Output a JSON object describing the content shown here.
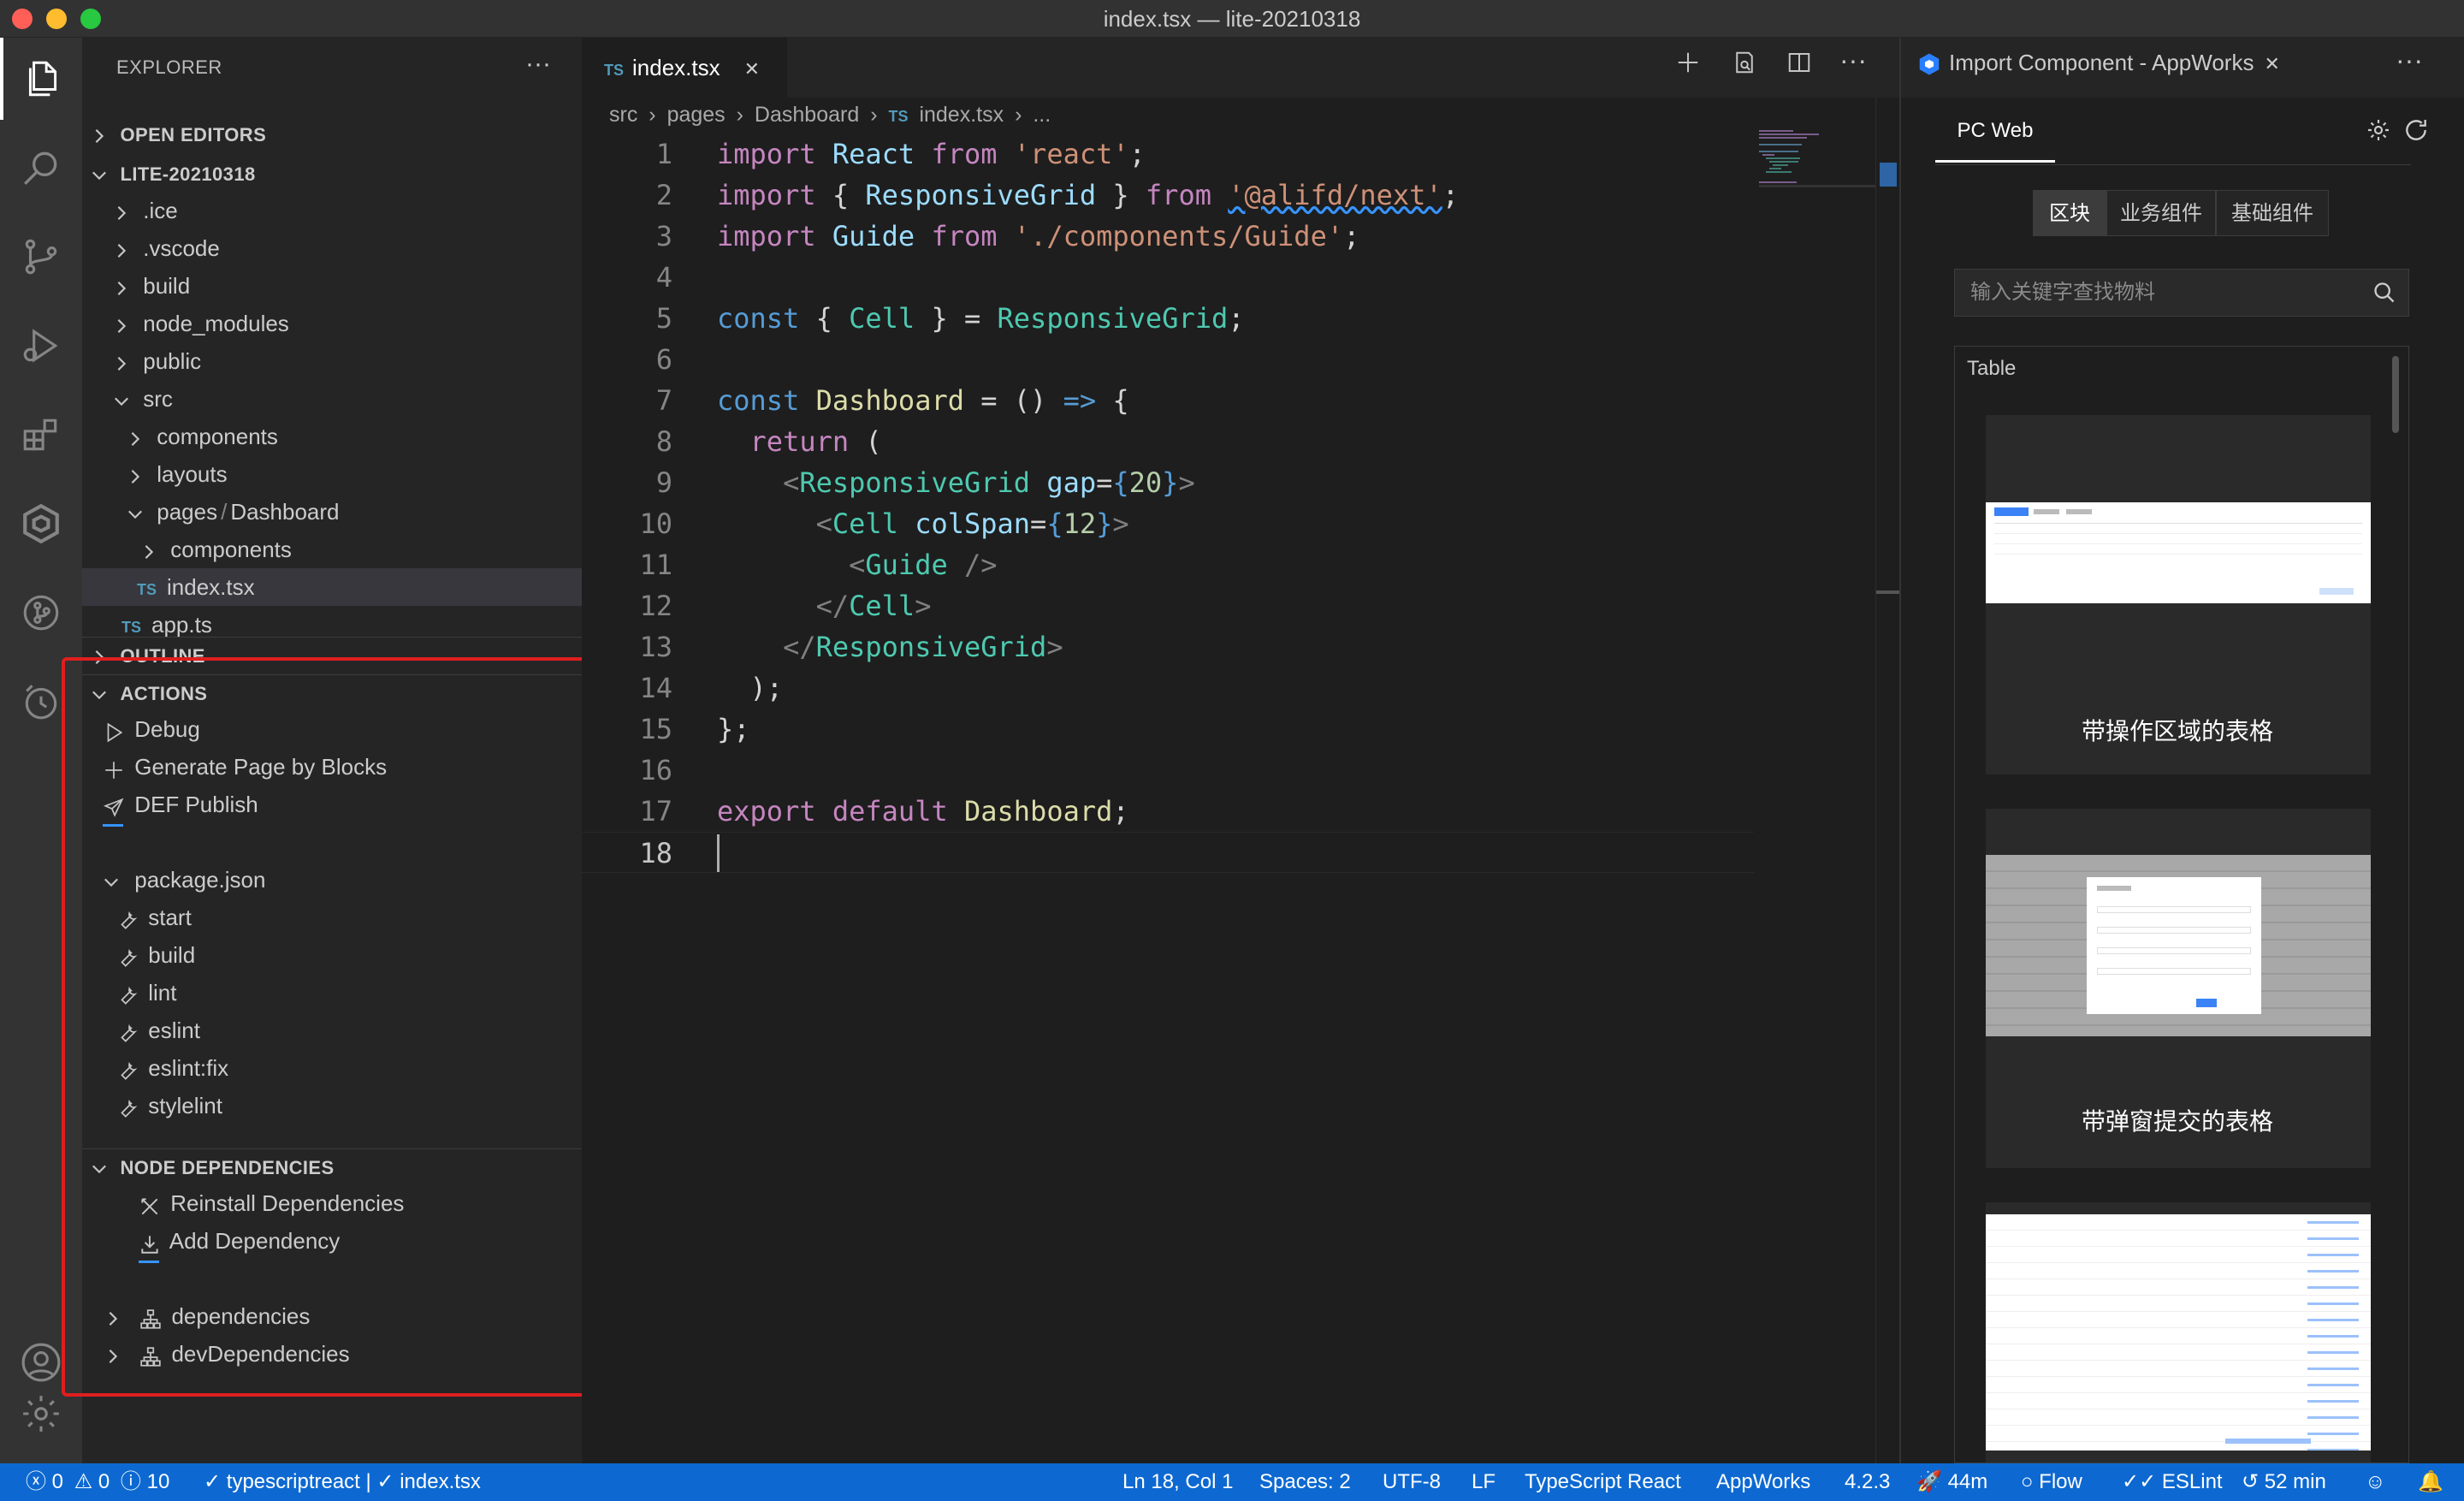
{
  "window": {
    "title": "index.tsx — lite-20210318"
  },
  "activity": [
    "explorer-icon",
    "search-icon",
    "source-control-icon",
    "run-debug-icon",
    "extensions-icon",
    "appworks-icon",
    "git-graph-icon",
    "timeline-icon",
    "account-icon",
    "settings-gear-icon"
  ],
  "sidebar": {
    "title": "EXPLORER",
    "more": "···",
    "open_editors": "OPEN EDITORS",
    "project": "LITE-20210318",
    "tree": [
      ".ice",
      ".vscode",
      "build",
      "node_modules",
      "public",
      "src",
      "components",
      "layouts",
      "pages",
      "Dashboard",
      "components",
      "index.tsx",
      "app.ts"
    ],
    "ts_badge": "TS",
    "path_sep": "/",
    "outline": "OUTLINE",
    "actions": {
      "title": "ACTIONS",
      "items": [
        "Debug",
        "Generate Page by Blocks",
        "DEF Publish"
      ],
      "package_json": "package.json",
      "scripts": [
        "start",
        "build",
        "lint",
        "eslint",
        "eslint:fix",
        "stylelint"
      ]
    },
    "node_deps": {
      "title": "NODE DEPENDENCIES",
      "items": [
        "Reinstall Dependencies",
        "Add Dependency"
      ],
      "groups": [
        "dependencies",
        "devDependencies"
      ]
    }
  },
  "editor": {
    "tab": {
      "badge": "TS",
      "name": "index.tsx",
      "close": "✕"
    },
    "breadcrumb": {
      "parts": [
        "src",
        "pages",
        "Dashboard"
      ],
      "badge": "TS",
      "file": "index.tsx",
      "more": "..."
    },
    "lines": [
      {
        "n": "1"
      },
      {
        "n": "2"
      },
      {
        "n": "3"
      },
      {
        "n": "4"
      },
      {
        "n": "5"
      },
      {
        "n": "6"
      },
      {
        "n": "7"
      },
      {
        "n": "8"
      },
      {
        "n": "9"
      },
      {
        "n": "10"
      },
      {
        "n": "11"
      },
      {
        "n": "12"
      },
      {
        "n": "13"
      },
      {
        "n": "14"
      },
      {
        "n": "15"
      },
      {
        "n": "16"
      },
      {
        "n": "17"
      },
      {
        "n": "18"
      }
    ],
    "code": {
      "import": "import",
      "from": "from",
      "const": "const",
      "return": "return",
      "export": "export",
      "default": "default",
      "React": "React",
      "react": "'react'",
      "ResponsiveGrid": "ResponsiveGrid",
      "alifd": "'@alifd/next'",
      "Guide": "Guide",
      "guide_path": "'./components/Guide'",
      "Cell": "Cell",
      "Dashboard": "Dashboard",
      "gap": "gap",
      "gap_val": "20",
      "colSpan": "colSpan",
      "col_val": "12"
    }
  },
  "panel": {
    "title": "Import Component - AppWorks",
    "close": "✕",
    "more": "···",
    "tab": "PC Web",
    "segments": [
      "区块",
      "业务组件",
      "基础组件"
    ],
    "search_placeholder": "输入关键字查找物料",
    "list_title": "Table",
    "cards": [
      "带操作区域的表格",
      "带弹窗提交的表格"
    ]
  },
  "statusbar": {
    "errors": "0",
    "warnings": "0",
    "infos": "10",
    "lang_check": "typescriptreact | ",
    "file_check": "index.tsx",
    "position": "Ln 18, Col 1",
    "spaces": "Spaces: 2",
    "encoding": "UTF-8",
    "eol": "LF",
    "language": "TypeScript React",
    "appworks": "AppWorks",
    "version": "4.2.3",
    "rocket": "44m",
    "flow": "Flow",
    "eslint": "ESLint",
    "timer": "52 min"
  },
  "colors": {
    "accent": "#0d69d1",
    "highlight": "#e01e1e",
    "keyword": "#569cd6",
    "string": "#ce9178",
    "type": "#4ec9b0"
  }
}
